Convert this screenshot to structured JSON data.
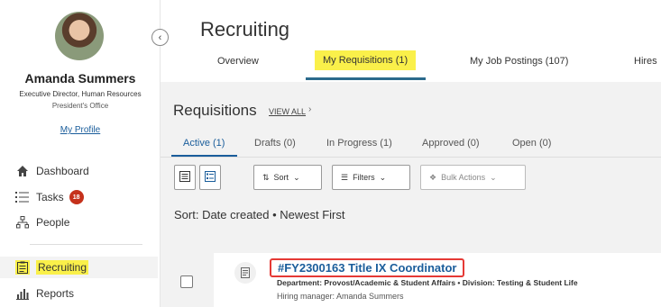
{
  "sidebar": {
    "user": {
      "name": "Amanda Summers",
      "title": "Executive Director, Human Resources",
      "office": "President's Office",
      "profile_link": "My Profile"
    },
    "items": [
      {
        "label": "Dashboard",
        "icon": "home-icon"
      },
      {
        "label": "Tasks",
        "icon": "list-icon",
        "badge": "18"
      },
      {
        "label": "People",
        "icon": "org-chart-icon"
      },
      {
        "label": "Recruiting",
        "icon": "clipboard-icon",
        "active": true
      },
      {
        "label": "Reports",
        "icon": "bar-chart-icon"
      }
    ],
    "collapse_icon": "chevron-left-icon"
  },
  "header": {
    "title": "Recruiting",
    "tabs": [
      {
        "label": "Overview"
      },
      {
        "label": "My Requisitions (1)",
        "active": true
      },
      {
        "label": "My Job Postings (107)"
      },
      {
        "label": "Hires"
      }
    ]
  },
  "requisitions": {
    "title": "Requisitions",
    "view_all": "VIEW ALL",
    "tabs": [
      {
        "label": "Active (1)",
        "active": true
      },
      {
        "label": "Drafts (0)"
      },
      {
        "label": "In Progress (1)"
      },
      {
        "label": "Approved (0)"
      },
      {
        "label": "Open (0)"
      }
    ],
    "toolbar": {
      "sort": "Sort",
      "filters": "Filters",
      "bulk_actions": "Bulk Actions"
    },
    "sort_description": "Sort: Date created • Newest First",
    "rows": [
      {
        "title": "#FY2300163 Title IX Coordinator",
        "department": "Department: Provost/Academic & Student Affairs • Division: Testing & Student Life",
        "hiring_manager": "Hiring manager: Amanda Summers"
      }
    ]
  },
  "colors": {
    "accent": "#1a5d9b",
    "highlight": "#faf04a",
    "badge": "#c5311b",
    "row_title_border": "#e53935"
  }
}
